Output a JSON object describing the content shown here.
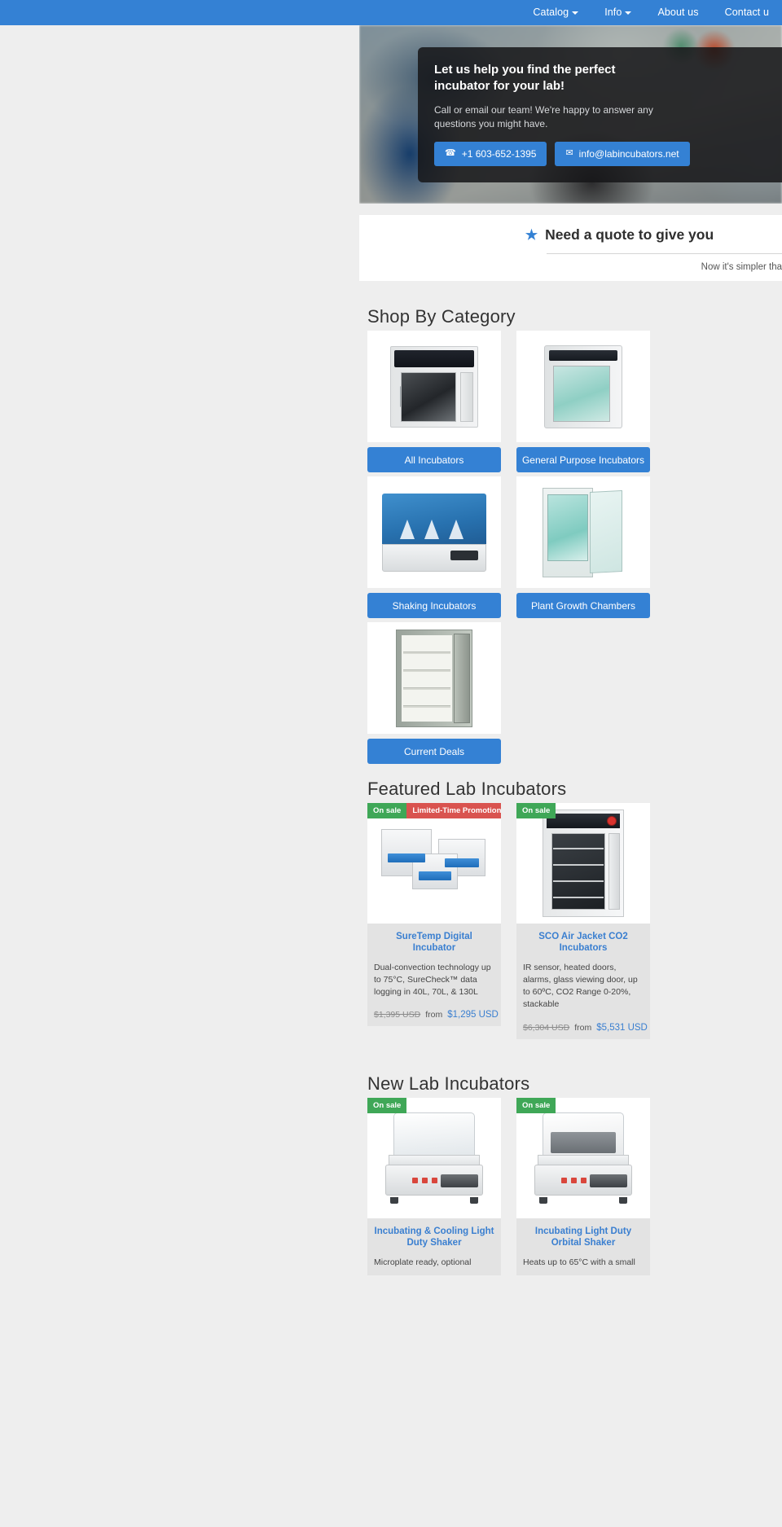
{
  "nav": {
    "items": [
      {
        "label": "Catalog",
        "has_caret": true
      },
      {
        "label": "Info",
        "has_caret": true
      },
      {
        "label": "About us",
        "has_caret": false
      },
      {
        "label": "Contact u",
        "has_caret": false
      }
    ]
  },
  "hero": {
    "title": "Let us help you find the perfect incubator for your lab!",
    "subtitle": "Call or email our team! We're happy to answer any questions you might have.",
    "phone_label": "+1 603-652-1395",
    "phone_icon": "📞",
    "email_label": "info@labincubators.net",
    "email_icon": "✉",
    "accent_color": "#3481d4"
  },
  "quote": {
    "star_icon": "★",
    "heading": "Need a quote to give you",
    "subtext": "Now it's simpler tha"
  },
  "sections": {
    "categories_title": "Shop By Category",
    "featured_title": "Featured Lab Incubators",
    "new_title": "New Lab Incubators"
  },
  "categories": [
    {
      "label": "All Incubators",
      "art": "oven"
    },
    {
      "label": "General Purpose Incubators",
      "art": "gp"
    },
    {
      "label": "Shaking Incubators",
      "art": "shake"
    },
    {
      "label": "Plant Growth Chambers",
      "art": "plant"
    },
    {
      "label": "Current Deals",
      "art": "deals"
    }
  ],
  "featured_products": [
    {
      "title": "SureTemp Digital Incubator",
      "description": "Dual-convection technology up to 75°C, SureCheck™ data logging in 40L, 70L, & 130L",
      "badges": [
        {
          "text": "On sale",
          "type": "sale"
        },
        {
          "text": "Limited-Time Promotion",
          "type": "promo"
        }
      ],
      "price_old": "$1,395 USD",
      "price_from": "from",
      "price_new": "$1,295 USD",
      "art": "suretemp"
    },
    {
      "title": "SCO Air Jacket CO2 Incubators",
      "description": "IR sensor, heated doors, alarms, glass viewing door, up to 60ºC, CO2 Range 0-20%, stackable",
      "badges": [
        {
          "text": "On sale",
          "type": "sale"
        }
      ],
      "price_old": "$6,304 USD",
      "price_from": "from",
      "price_new": "$5,531 USD",
      "art": "sco"
    }
  ],
  "new_products": [
    {
      "title": "Incubating & Cooling Light Duty Shaker",
      "description": "Microplate ready, optional",
      "badges": [
        {
          "text": "On sale",
          "type": "sale"
        }
      ],
      "art": "shaker-white"
    },
    {
      "title": "Incubating Light Duty Orbital Shaker",
      "description": "Heats up to 65°C with a small",
      "badges": [
        {
          "text": "On sale",
          "type": "sale"
        }
      ],
      "art": "shaker-gray"
    }
  ]
}
